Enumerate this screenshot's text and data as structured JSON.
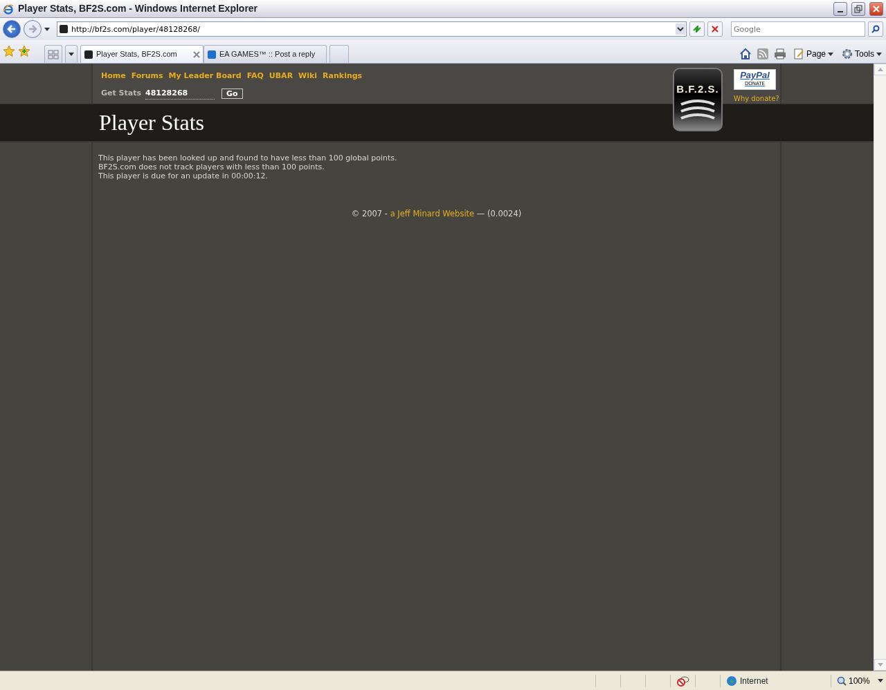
{
  "window": {
    "title": "Player Stats, BF2S.com - Windows Internet Explorer"
  },
  "address_bar": {
    "url": "http://bf2s.com/player/48128268/"
  },
  "search": {
    "placeholder": "Google"
  },
  "tabs": [
    {
      "label": "Player Stats, BF2S.com",
      "selected": true
    },
    {
      "label": "EA GAMES™ :: Post a reply",
      "selected": false
    }
  ],
  "command_bar": [
    {
      "label": "Page"
    },
    {
      "label": "Tools"
    }
  ],
  "site": {
    "nav": [
      "Home",
      "Forums",
      "My Leader Board",
      "FAQ",
      "UBAR",
      "Wiki",
      "Rankings"
    ],
    "get_stats": {
      "label": "Get Stats",
      "value": "48128268",
      "button": "Go"
    },
    "logo": "B.F.2.S.",
    "paypal": {
      "brand": "PayPal",
      "action": "DONATE"
    },
    "why_donate": "Why donate?",
    "heading": "Player Stats",
    "messages": [
      "This player has been looked up and found to have less than 100 global points.",
      "BF2S.com does not track players with less than 100 points.",
      "This player is due for an update in 00:00:12."
    ],
    "footer": {
      "prefix": "© 2007 - ",
      "link": "a Jeff Minard Website",
      "suffix": " — (0.0024)"
    }
  },
  "status_bar": {
    "zone": "Internet",
    "zoom": "100%"
  }
}
